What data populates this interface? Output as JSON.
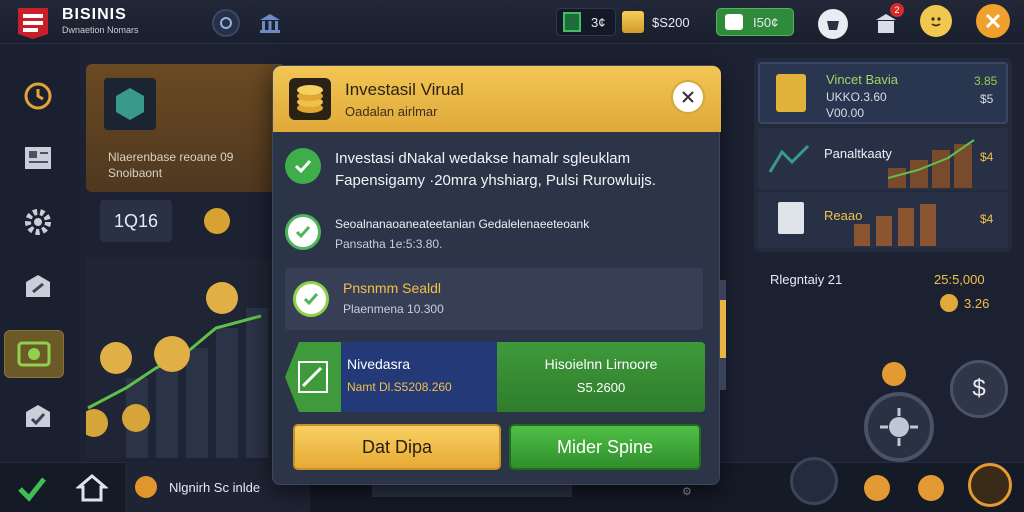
{
  "app": {
    "title": "BISINIS",
    "subtitle": "Dwnaetion Nomars"
  },
  "topbar": {
    "energy_value": "3¢",
    "gold_value": "$S200",
    "cash_value": "I50¢",
    "notification_badge": "2"
  },
  "background": {
    "card_text_line1": "Nlaerenbase reoane 09",
    "card_text_line2": "Snoibaont",
    "counter_value": "1Q16"
  },
  "modal": {
    "title": "Investasil Virual",
    "subtitle": "Oadalan airlmar",
    "row1_line1": "Investasi dNakal wedakse hamalr sgleuklam",
    "row1_line2": "Fapensigamy ·20mra yhshiarg, Pulsi Rurowluijs.",
    "row2_line1": "Seoalnanaoaneateetanian Gedalelenaeeteoank",
    "row2_line2": "Pansatha 1e:5:3.80.",
    "row3_line1": "Pnsnmm Sealdl",
    "row3_line2": "Plaenmena 10.300",
    "compare_left_title": "Nivedasra",
    "compare_left_value": "Namt Dl.S5208.260",
    "compare_right_title": "Hisoielnn Lirnoore",
    "compare_right_value": "S5.2600",
    "btn_left": "Dat Dipa",
    "btn_right": "Mider Spine"
  },
  "right_panel": {
    "row1_title": "Vincet Bavia",
    "row1_sub": "UKKO.3.60",
    "row1_sub2": "V00.00",
    "row1_value": "3.85",
    "row1_value2": "$5",
    "row2_title": "Panaltkaaty",
    "row2_value": "$4",
    "row3_title": "Reaao",
    "row3_value": "$4"
  },
  "balance": {
    "label": "Rlegntaiy 21",
    "value": "25:5,000",
    "sub_value": "3.26"
  },
  "bottom": {
    "ticker_text": "Nlgnirh Sc inlde"
  },
  "colors": {
    "accent_gold": "#f2c04a",
    "accent_green": "#3f9a3b",
    "accent_blue": "#243a78"
  }
}
